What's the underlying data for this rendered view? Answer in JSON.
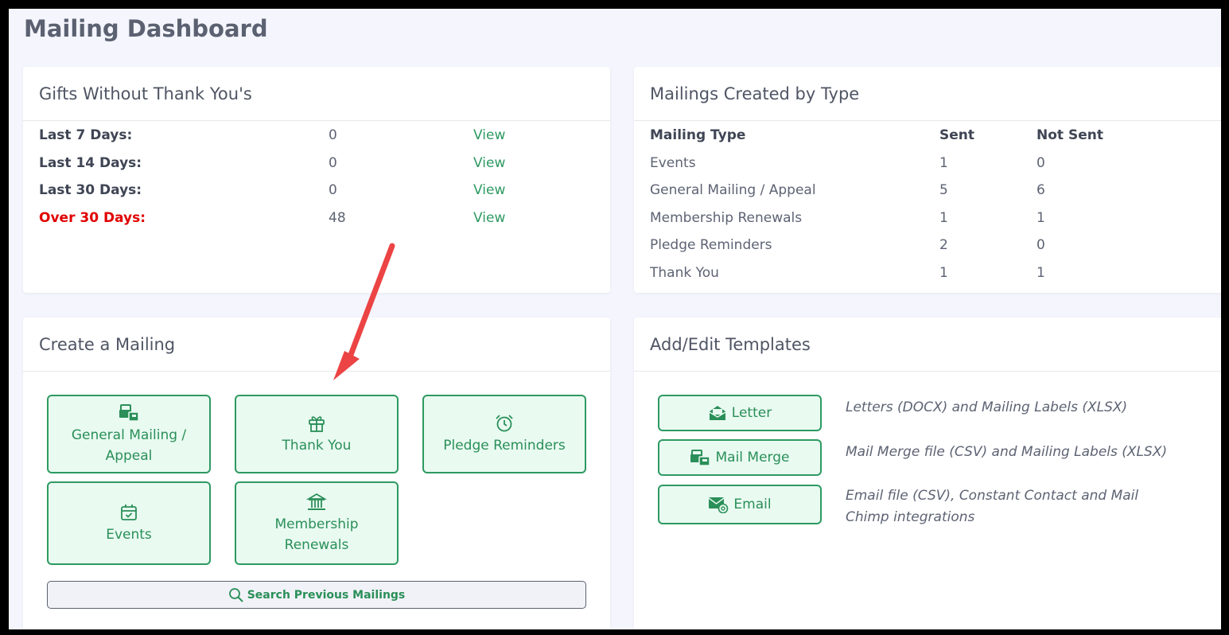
{
  "page": {
    "title": "Mailing Dashboard"
  },
  "gifts": {
    "title": "Gifts Without Thank You's",
    "rows": [
      {
        "label": "Last 7 Days:",
        "value": "0",
        "link": "View"
      },
      {
        "label": "Last 14 Days:",
        "value": "0",
        "link": "View"
      },
      {
        "label": "Last 30 Days:",
        "value": "0",
        "link": "View"
      },
      {
        "label": "Over 30 Days:",
        "value": "48",
        "link": "View"
      }
    ]
  },
  "types": {
    "title": "Mailings Created by Type",
    "headers": {
      "type": "Mailing Type",
      "sent": "Sent",
      "not_sent": "Not Sent"
    },
    "rows": [
      {
        "type": "Events",
        "sent": "1",
        "not_sent": "0"
      },
      {
        "type": "General Mailing / Appeal",
        "sent": "5",
        "not_sent": "6"
      },
      {
        "type": "Membership Renewals",
        "sent": "1",
        "not_sent": "1"
      },
      {
        "type": "Pledge Reminders",
        "sent": "2",
        "not_sent": "0"
      },
      {
        "type": "Thank You",
        "sent": "1",
        "not_sent": "1"
      }
    ]
  },
  "create": {
    "title": "Create a Mailing",
    "buttons": {
      "general_l1": "General Mailing /",
      "general_l2": "Appeal",
      "thank_you": "Thank You",
      "pledge": "Pledge Reminders",
      "events": "Events",
      "membership_l1": "Membership",
      "membership_l2": "Renewals"
    },
    "search_label": "Search Previous Mailings"
  },
  "templates": {
    "title": "Add/Edit Templates",
    "items": [
      {
        "label": "Letter",
        "icon": "envelope-open-icon",
        "desc": "Letters (DOCX) and Mailing Labels (XLSX)"
      },
      {
        "label": "Mail Merge",
        "icon": "mail-bulk-icon",
        "desc": "Mail Merge file (CSV) and Mailing Labels (XLSX)"
      },
      {
        "label": "Email",
        "icon": "envelope-at-icon",
        "desc": "Email file (CSV), Constant Contact and Mail Chimp integrations"
      }
    ]
  },
  "colors": {
    "accent": "#2e9a62",
    "warning": "#e00000",
    "arrow": "#ec4444"
  }
}
